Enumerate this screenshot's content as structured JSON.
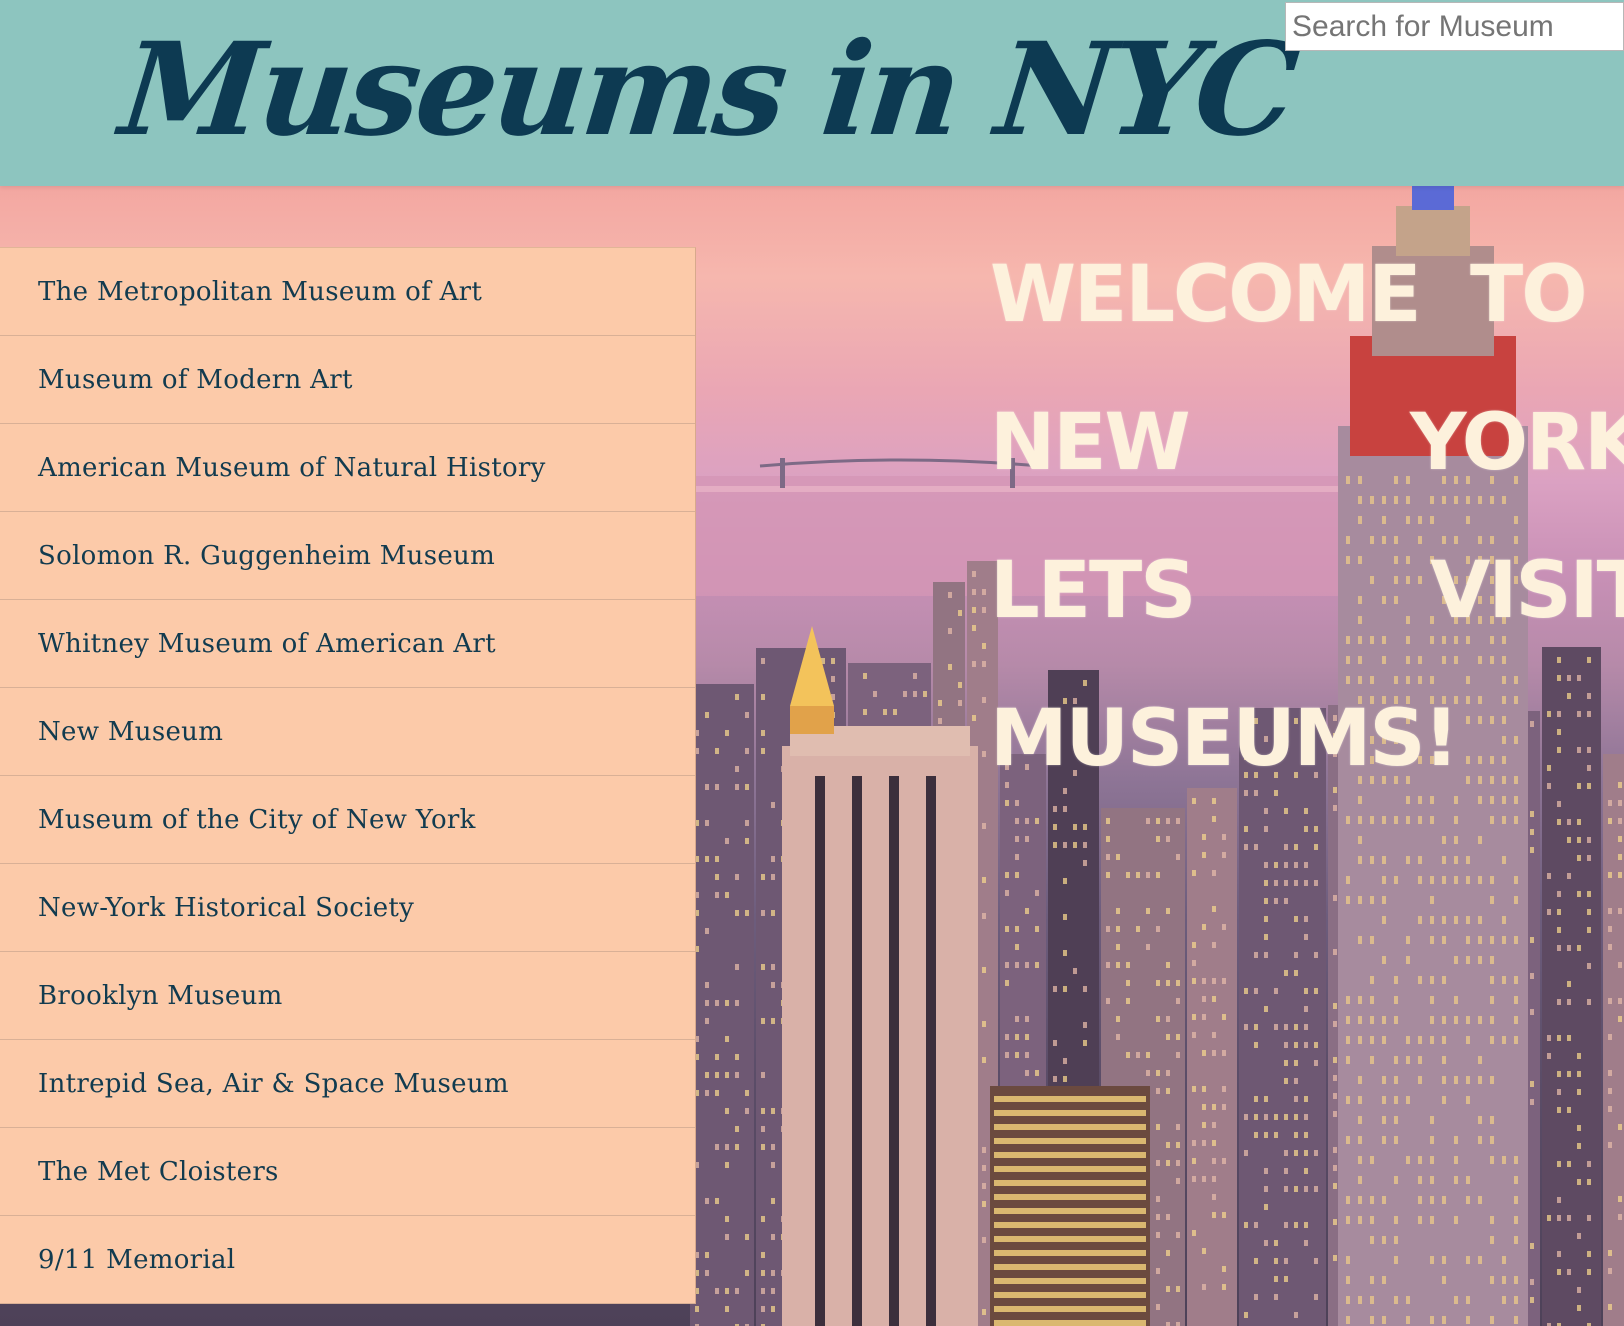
{
  "header": {
    "title": "Museums in NYC",
    "search_placeholder": "Search for Museum",
    "background": "#8dc5bf",
    "title_color": "#0d3a52"
  },
  "sidebar": {
    "background": "#fccaa9",
    "items": [
      {
        "label": "The Metropolitan Museum of Art"
      },
      {
        "label": "Museum of Modern Art"
      },
      {
        "label": "American Museum of Natural History"
      },
      {
        "label": "Solomon R. Guggenheim Museum"
      },
      {
        "label": "Whitney Museum of American Art"
      },
      {
        "label": "New Museum"
      },
      {
        "label": "Museum of the City of New York"
      },
      {
        "label": "New-York Historical Society"
      },
      {
        "label": "Brooklyn Museum"
      },
      {
        "label": "Intrepid Sea, Air & Space Museum"
      },
      {
        "label": "The Met Cloisters"
      },
      {
        "label": "9/11 Memorial"
      }
    ]
  },
  "welcome": {
    "words": [
      "WELCOME",
      "TO",
      "NEW",
      "YORK!",
      "LETS",
      "VISIT",
      "MUSEUMS!"
    ],
    "color": "#fdf1dc"
  }
}
